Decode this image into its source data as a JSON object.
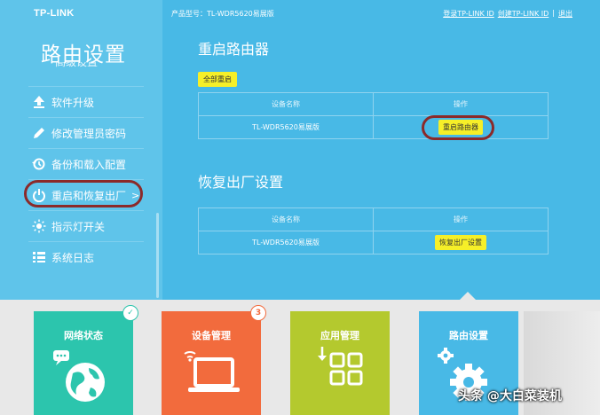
{
  "brand": "TP-LINK",
  "sidebar": {
    "title": "路由设置",
    "cut_item": "高级设置",
    "items": [
      {
        "label": "软件升级",
        "icon": "upload-icon"
      },
      {
        "label": "修改管理员密码",
        "icon": "pencil-icon"
      },
      {
        "label": "备份和载入配置",
        "icon": "restore-icon"
      },
      {
        "label": "重启和恢复出厂",
        "icon": "power-icon",
        "arrow": ">"
      },
      {
        "label": "指示灯开关",
        "icon": "light-icon"
      },
      {
        "label": "系统日志",
        "icon": "list-icon"
      }
    ]
  },
  "header": {
    "model_label": "产品型号：TL-WDR5620易展版",
    "login_link": "登录TP-LINK ID",
    "create_link": "创建TP-LINK ID",
    "sep": "|",
    "exit_link": "退出"
  },
  "reboot": {
    "title": "重启路由器",
    "all_button": "全部重启",
    "col_name": "设备名称",
    "col_action": "操作",
    "device": "TL-WDR5620易展版",
    "action_button": "重启路由器"
  },
  "factory": {
    "title": "恢复出厂设置",
    "col_name": "设备名称",
    "col_action": "操作",
    "device": "TL-WDR5620易展版",
    "action_button": "恢复出厂设置"
  },
  "tiles": [
    {
      "label": "网络状态",
      "color": "#2cc5ad",
      "badge": "✓"
    },
    {
      "label": "设备管理",
      "color": "#f26b3d",
      "badge": "3"
    },
    {
      "label": "应用管理",
      "color": "#b4c92e"
    },
    {
      "label": "路由设置",
      "color": "#48b9e6"
    }
  ],
  "watermark": "头条 @大白菜装机"
}
